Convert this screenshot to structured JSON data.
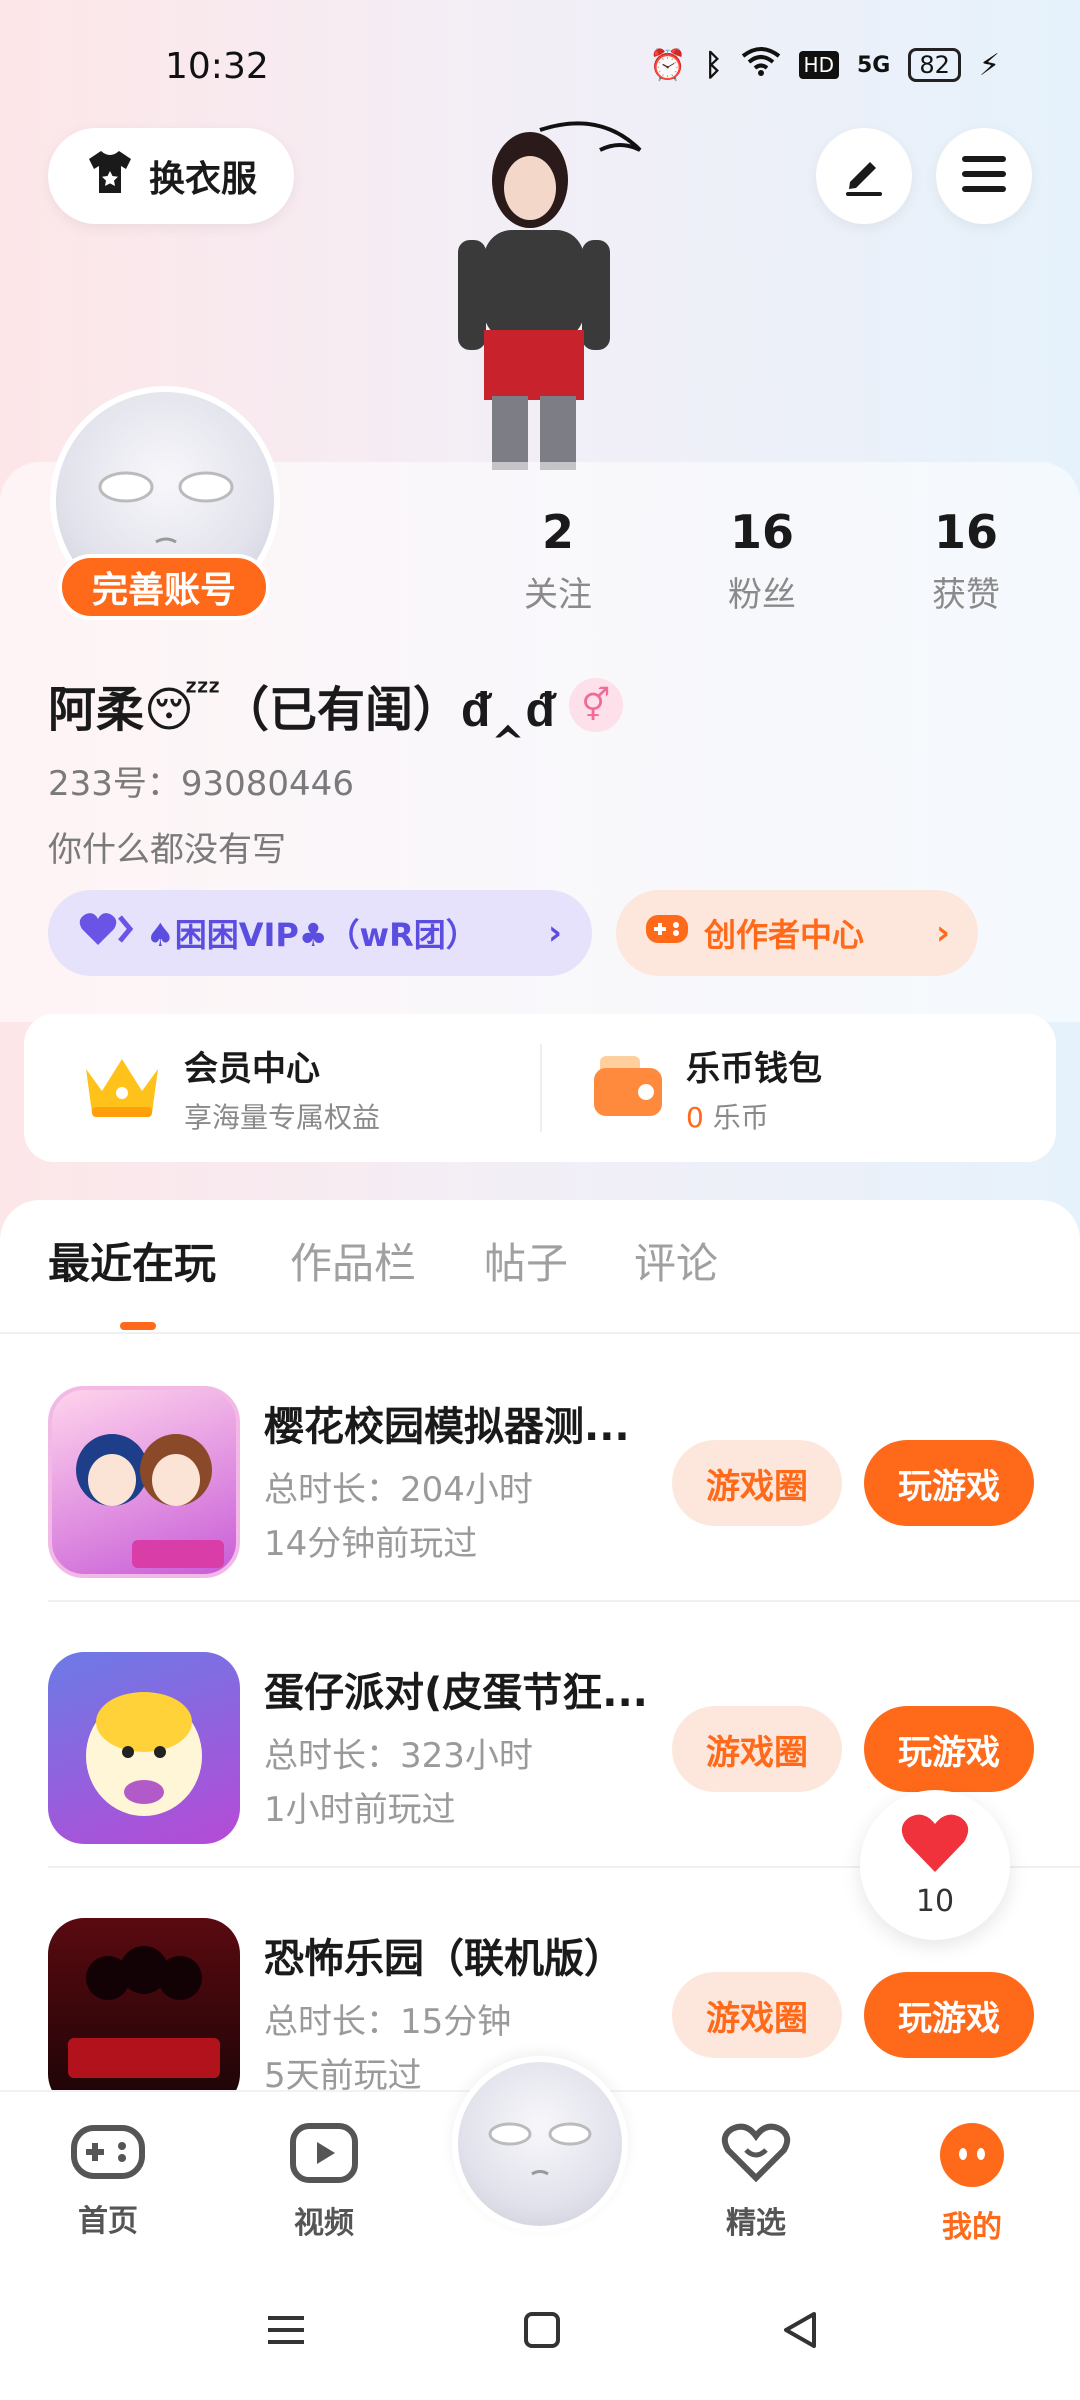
{
  "status_bar": {
    "time": "10:32",
    "network": "5G",
    "hd": "HD",
    "battery": "82"
  },
  "header": {
    "wardrobe_label": "换衣服"
  },
  "profile": {
    "complete_label": "完善账号",
    "stats": [
      {
        "value": "2",
        "label": "关注"
      },
      {
        "value": "16",
        "label": "粉丝"
      },
      {
        "value": "16",
        "label": "获赞"
      }
    ],
    "nickname": "阿柔😴（已有闺）ᵭ‸ᵭ",
    "gender_symbol": "⚥",
    "uid": "233号：93080446",
    "bio": "你什么都没有写",
    "vip_label": "♠困困VIP♣（wR团）",
    "creator_label": "创作者中心"
  },
  "member": {
    "vip_title": "会员中心",
    "vip_sub": "享海量专属权益",
    "wallet_title": "乐币钱包",
    "wallet_amount": "0",
    "wallet_unit": "乐币"
  },
  "tabs": [
    {
      "label": "最近在玩",
      "active": true
    },
    {
      "label": "作品栏",
      "active": false
    },
    {
      "label": "帖子",
      "active": false
    },
    {
      "label": "评论",
      "active": false
    }
  ],
  "games": [
    {
      "title": "樱花校园模拟器测...",
      "duration": "总时长：204小时",
      "last_played": "14分钟前玩过",
      "circle_label": "游戏圈",
      "play_label": "玩游戏"
    },
    {
      "title": "蛋仔派对(皮蛋节狂...",
      "duration": "总时长：323小时",
      "last_played": "1小时前玩过",
      "circle_label": "游戏圈",
      "play_label": "玩游戏"
    },
    {
      "title": "恐怖乐园（联机版）",
      "duration": "总时长：15分钟",
      "last_played": "5天前玩过",
      "circle_label": "游戏圈",
      "play_label": "玩游戏"
    }
  ],
  "like": {
    "count": "10"
  },
  "bottom_nav": [
    {
      "label": "首页",
      "icon": "gamepad-icon",
      "active": false
    },
    {
      "label": "视频",
      "icon": "video-icon",
      "active": false
    },
    {
      "label": "精选",
      "icon": "heart-icon",
      "active": false
    },
    {
      "label": "我的",
      "icon": "profile-face-icon",
      "active": true
    }
  ],
  "colors": {
    "accent": "#ff6a1a",
    "vip": "#5b4de0"
  }
}
